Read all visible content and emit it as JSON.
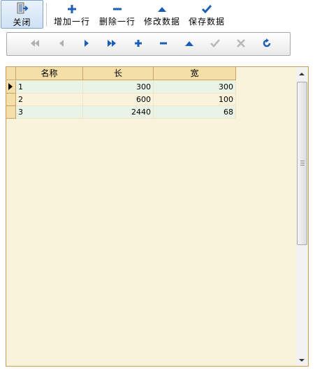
{
  "toolbar": {
    "close_label": "关闭",
    "add_row_label": "增加一行",
    "delete_row_label": "删除一行",
    "modify_label": "修改数据",
    "save_label": "保存数据"
  },
  "navigator": {
    "buttons": [
      "first-icon",
      "prior-icon",
      "next-icon",
      "last-icon",
      "insert-icon",
      "delete-icon",
      "edit-icon",
      "post-icon",
      "cancel-icon",
      "refresh-icon"
    ]
  },
  "grid": {
    "columns": [
      "名称",
      "长",
      "宽"
    ],
    "rows": [
      [
        "1",
        "300",
        "300"
      ],
      [
        "2",
        "600",
        "100"
      ],
      [
        "3",
        "2440",
        "68"
      ]
    ]
  },
  "colors": {
    "accent": "#1b5fb5",
    "grid_background": "#faf3dc",
    "header": "#f5dfa8",
    "cell": "#e9f4e6"
  }
}
